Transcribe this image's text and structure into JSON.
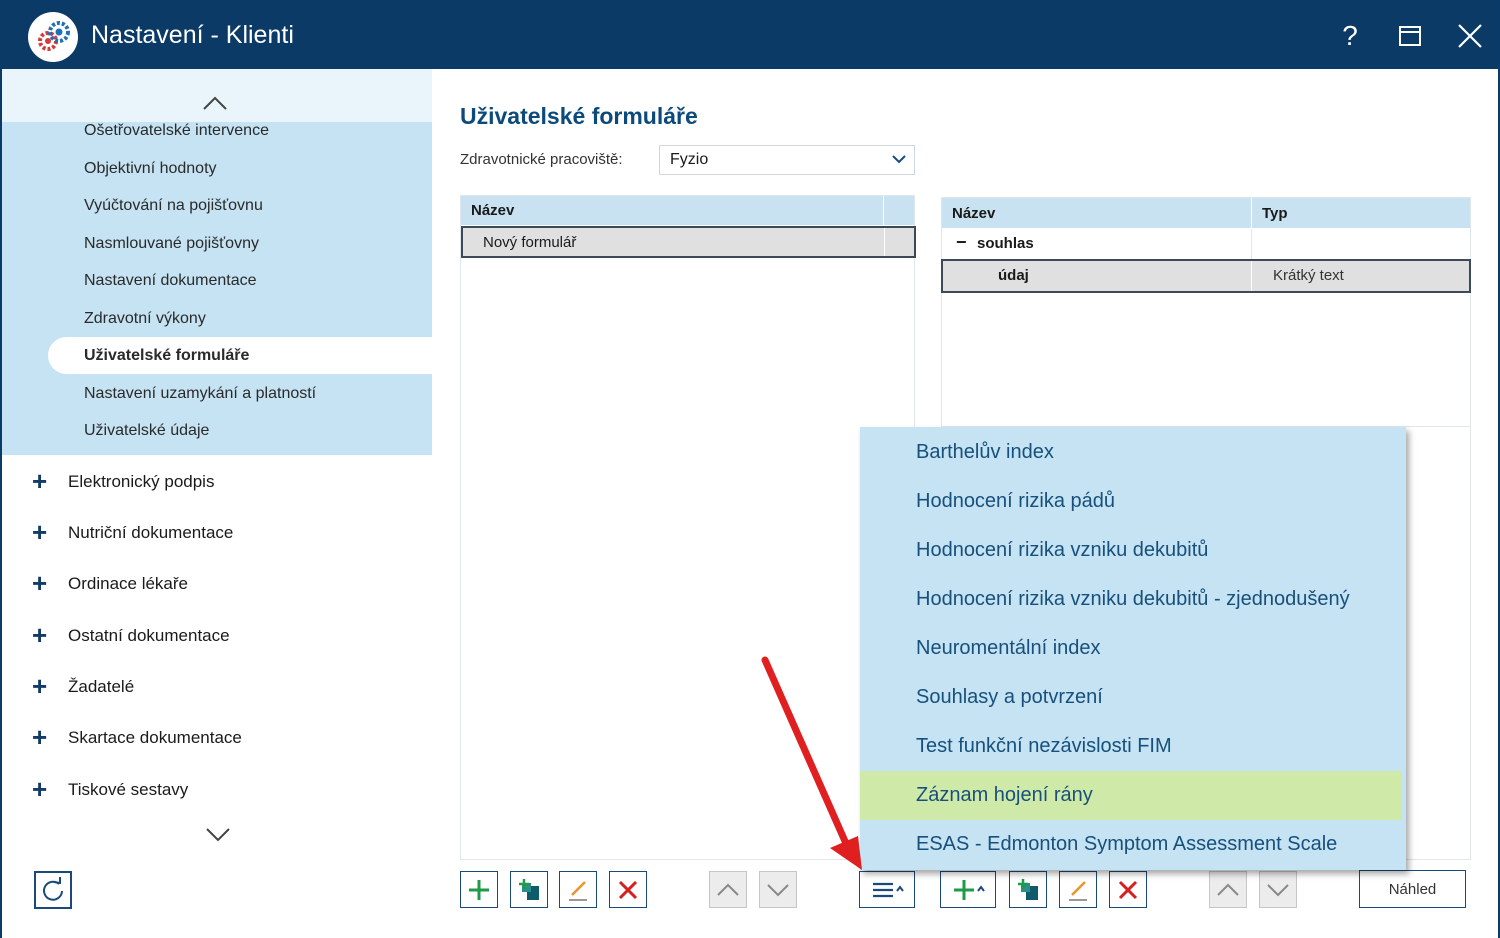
{
  "window": {
    "title": "Nastavení - Klienti",
    "help_label": "?",
    "colors": {
      "titlebar": "#0b3a66",
      "sidebar_active_bg": "#c5e3f3",
      "highlight": "#cfeaa8",
      "accent_text": "#0d4a7c"
    }
  },
  "sidebar": {
    "sub_items": [
      {
        "label": "Ošetřovatelské intervence"
      },
      {
        "label": "Objektivní hodnoty"
      },
      {
        "label": "Vyúčtování na pojišťovnu"
      },
      {
        "label": "Nasmlouvané pojišťovny"
      },
      {
        "label": "Nastavení dokumentace"
      },
      {
        "label": "Zdravotní výkony"
      },
      {
        "label": "Uživatelské formuláře",
        "active": true
      },
      {
        "label": "Nastavení uzamykání a platností"
      },
      {
        "label": "Uživatelské údaje"
      }
    ],
    "groups": [
      {
        "label": "Elektronický podpis"
      },
      {
        "label": "Nutriční dokumentace"
      },
      {
        "label": "Ordinace lékaře"
      },
      {
        "label": "Ostatní dokumentace"
      },
      {
        "label": "Žadatelé"
      },
      {
        "label": "Skartace dokumentace"
      },
      {
        "label": "Tiskové sestavy"
      }
    ]
  },
  "main": {
    "title": "Uživatelské formuláře",
    "workplace_label": "Zdravotnické pracoviště:",
    "workplace_value": "Fyzio",
    "forms_grid": {
      "header": "Název",
      "rows": [
        {
          "name": "Nový formulář"
        }
      ]
    },
    "fields_grid": {
      "header_name": "Název",
      "header_type": "Typ",
      "group_row": {
        "toggle": "−",
        "name": "souhlas"
      },
      "field_row": {
        "name": "údaj",
        "type": "Krátký text"
      }
    },
    "preview_label": "Náhled"
  },
  "template_menu": {
    "items": [
      {
        "label": "Barthelův index"
      },
      {
        "label": "Hodnocení rizika pádů"
      },
      {
        "label": "Hodnocení rizika vzniku dekubitů"
      },
      {
        "label": "Hodnocení rizika vzniku dekubitů - zjednodušený"
      },
      {
        "label": "Neuromentální index"
      },
      {
        "label": "Souhlasy a potvrzení"
      },
      {
        "label": "Test funkční nezávislosti FIM"
      },
      {
        "label": "Záznam hojení rány",
        "highlighted": true
      },
      {
        "label": "ESAS - Edmonton Symptom Assessment Scale"
      }
    ]
  }
}
